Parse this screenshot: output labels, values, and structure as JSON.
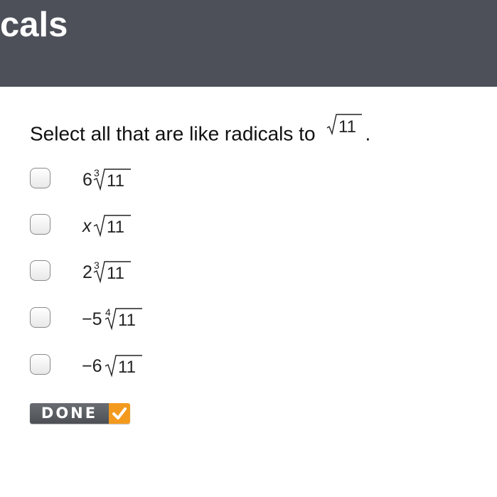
{
  "header": {
    "title": "cals"
  },
  "question": {
    "prompt_text": "Select all that are like radicals to",
    "prompt_radicand": "11",
    "prompt_end": "."
  },
  "options": [
    {
      "coefficient": "6",
      "index": "3",
      "radicand": "11",
      "checked": false
    },
    {
      "coefficient": "x",
      "index": "",
      "radicand": "11",
      "checked": false
    },
    {
      "coefficient": "2",
      "index": "3",
      "radicand": "11",
      "checked": false
    },
    {
      "coefficient": "−5",
      "index": "4",
      "radicand": "11",
      "checked": false
    },
    {
      "coefficient": "−6",
      "index": "",
      "radicand": "11",
      "checked": false
    }
  ],
  "done_button": {
    "label": "DONE"
  },
  "colors": {
    "header_bg": "#4d5058",
    "done_bg": "#5a5d62",
    "done_accent": "#f39a1e"
  },
  "icons": {
    "done_check": "checkmark-icon"
  }
}
